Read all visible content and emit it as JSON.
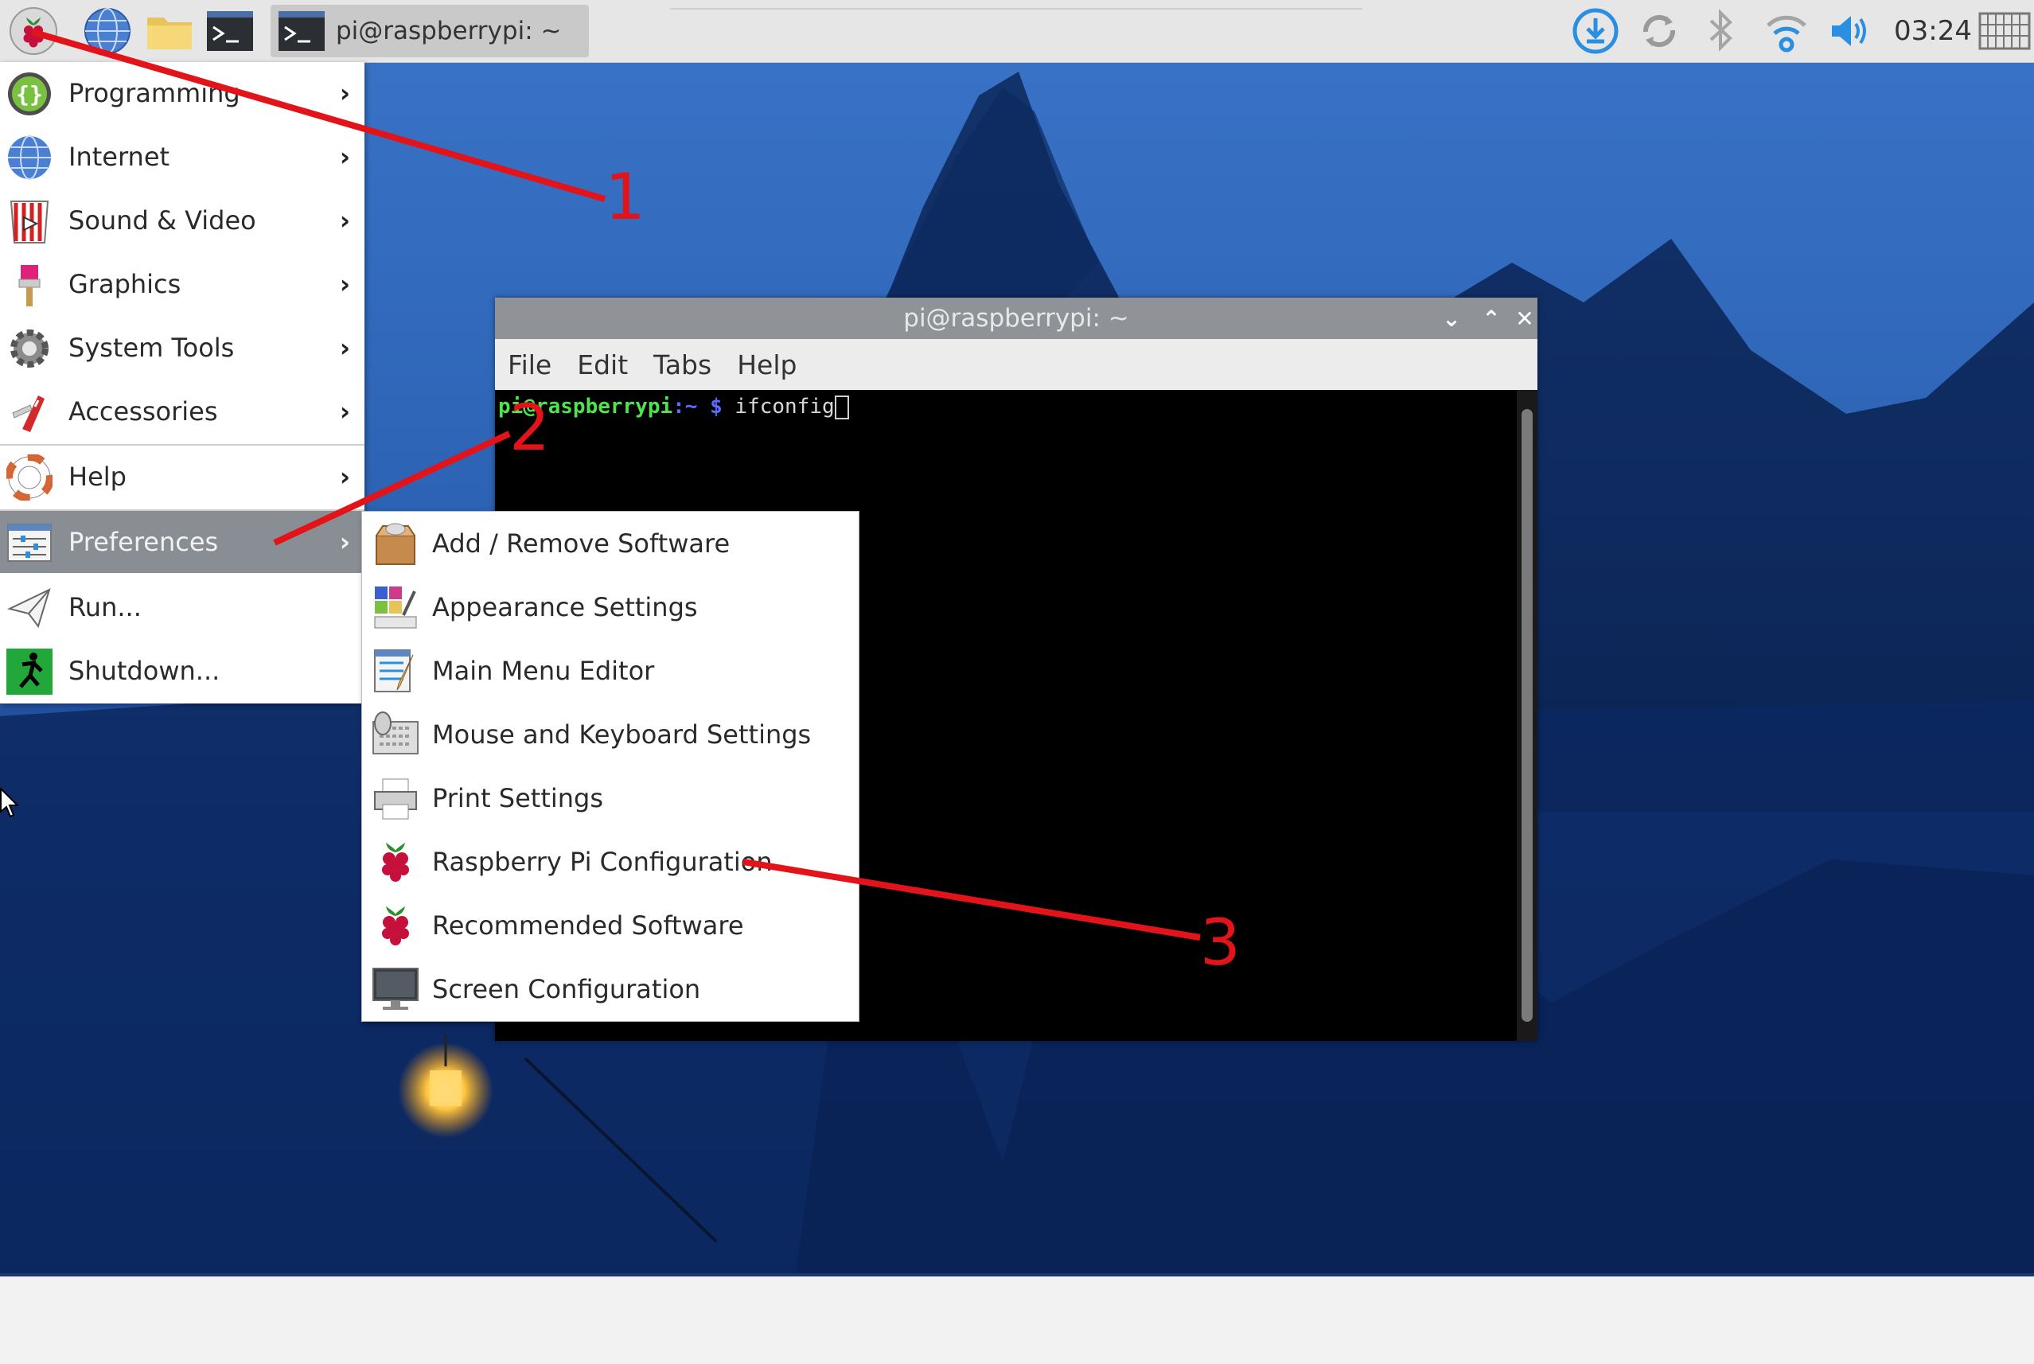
{
  "taskbar": {
    "task_label": "pi@raspberrypi: ~",
    "clock": "03:24",
    "icons": [
      "raspberry-menu-icon",
      "browser-globe-icon",
      "file-manager-folder-icon",
      "terminal-icon",
      "download-update-icon",
      "sync-icon",
      "bluetooth-icon",
      "wifi-icon",
      "volume-icon",
      "keyboard-icon"
    ]
  },
  "main_menu": {
    "items": [
      {
        "label": "Programming",
        "icon": "programming-icon"
      },
      {
        "label": "Internet",
        "icon": "internet-globe-icon"
      },
      {
        "label": "Sound & Video",
        "icon": "sound-video-icon"
      },
      {
        "label": "Graphics",
        "icon": "graphics-brush-icon"
      },
      {
        "label": "System Tools",
        "icon": "gear-icon"
      },
      {
        "label": "Accessories",
        "icon": "accessories-knife-icon"
      },
      {
        "label": "Help",
        "icon": "lifebuoy-icon"
      },
      {
        "label": "Preferences",
        "icon": "preferences-icon"
      },
      {
        "label": "Run...",
        "icon": "paper-plane-icon"
      },
      {
        "label": "Shutdown...",
        "icon": "running-man-icon"
      }
    ],
    "arrow": "›"
  },
  "preferences_submenu": {
    "items": [
      {
        "label": "Add / Remove Software",
        "icon": "package-icon"
      },
      {
        "label": "Appearance Settings",
        "icon": "appearance-icon"
      },
      {
        "label": "Main Menu Editor",
        "icon": "menu-editor-icon"
      },
      {
        "label": "Mouse and Keyboard Settings",
        "icon": "mouse-keyboard-icon"
      },
      {
        "label": "Print Settings",
        "icon": "printer-icon"
      },
      {
        "label": "Raspberry Pi Configuration",
        "icon": "raspberry-icon"
      },
      {
        "label": "Recommended Software",
        "icon": "raspberry-icon"
      },
      {
        "label": "Screen Configuration",
        "icon": "monitor-icon"
      }
    ]
  },
  "terminal": {
    "title": "pi@raspberrypi: ~",
    "menu": [
      "File",
      "Edit",
      "Tabs",
      "Help"
    ],
    "prompt_user": "pi@raspberrypi",
    "prompt_path": ":~ $",
    "command": " ifconfig",
    "buttons": {
      "minimize": "⌄",
      "maximize": "⌃",
      "close": "✕"
    }
  },
  "annotations": [
    "1",
    "2",
    "3"
  ],
  "colors": {
    "annotation": "#e2141a",
    "menu_active": "#888e94",
    "taskbar": "#e6e6e6"
  }
}
